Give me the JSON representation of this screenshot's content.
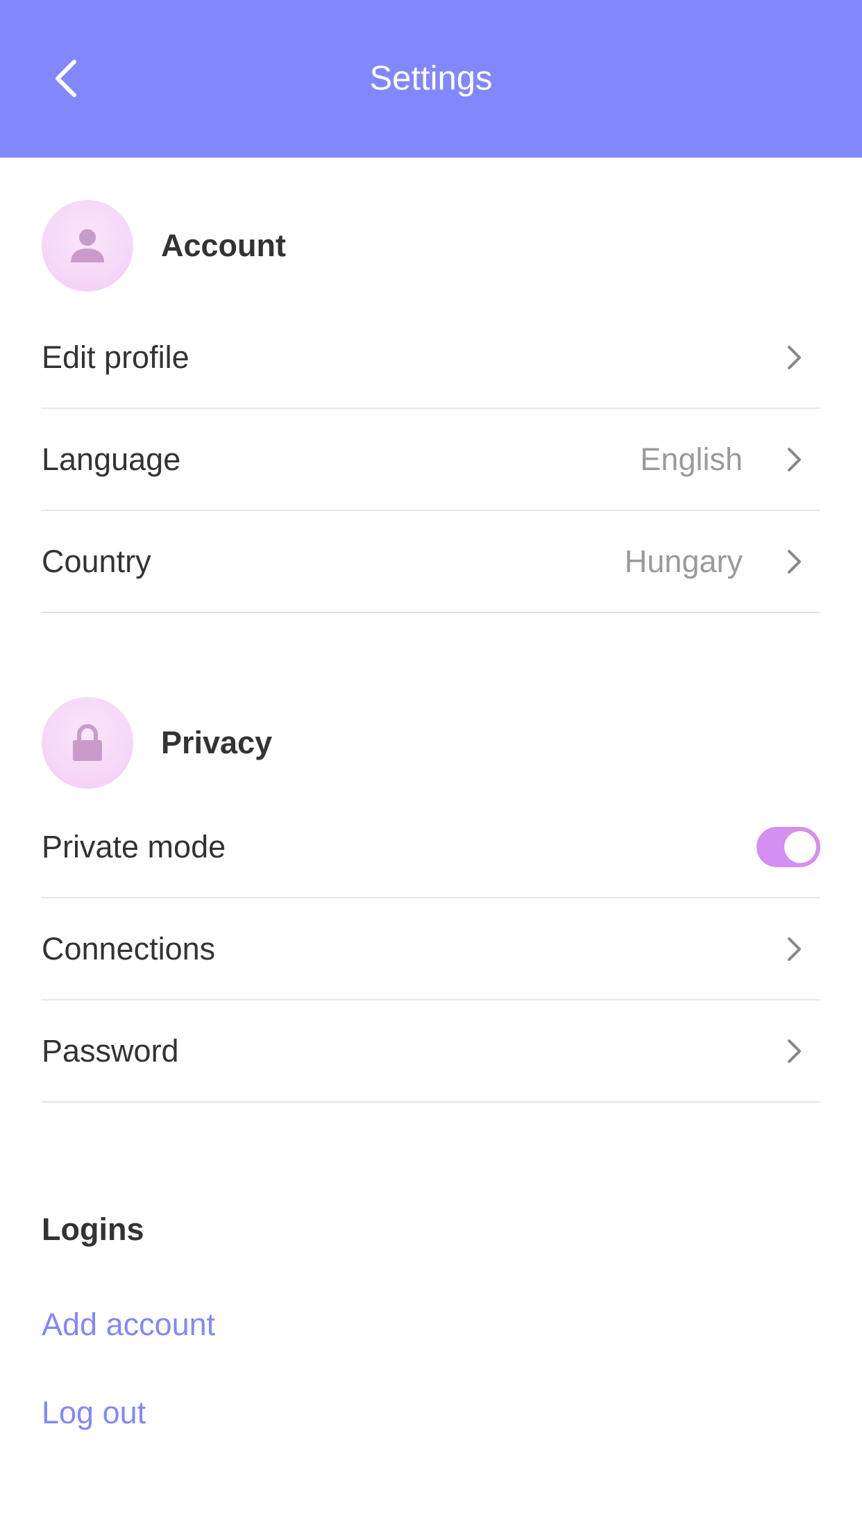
{
  "header": {
    "title": "Settings",
    "background_color": "#8288fc",
    "back_icon": "chevron-left-icon"
  },
  "account": {
    "title": "Account",
    "icon": "user-icon",
    "items": [
      {
        "label": "Edit profile",
        "value": ""
      },
      {
        "label": "Language",
        "value": "English"
      },
      {
        "label": "Country",
        "value": "Hungary"
      }
    ]
  },
  "privacy": {
    "title": "Privacy",
    "icon": "lock-icon",
    "private_mode": {
      "label": "Private mode",
      "enabled": true,
      "toggle_color": "#d48ff0"
    },
    "items": [
      {
        "label": "Connections"
      },
      {
        "label": "Password"
      }
    ]
  },
  "logins": {
    "title": "Logins",
    "add_account": "Add account",
    "log_out": "Log out",
    "link_color": "#8288fc"
  }
}
